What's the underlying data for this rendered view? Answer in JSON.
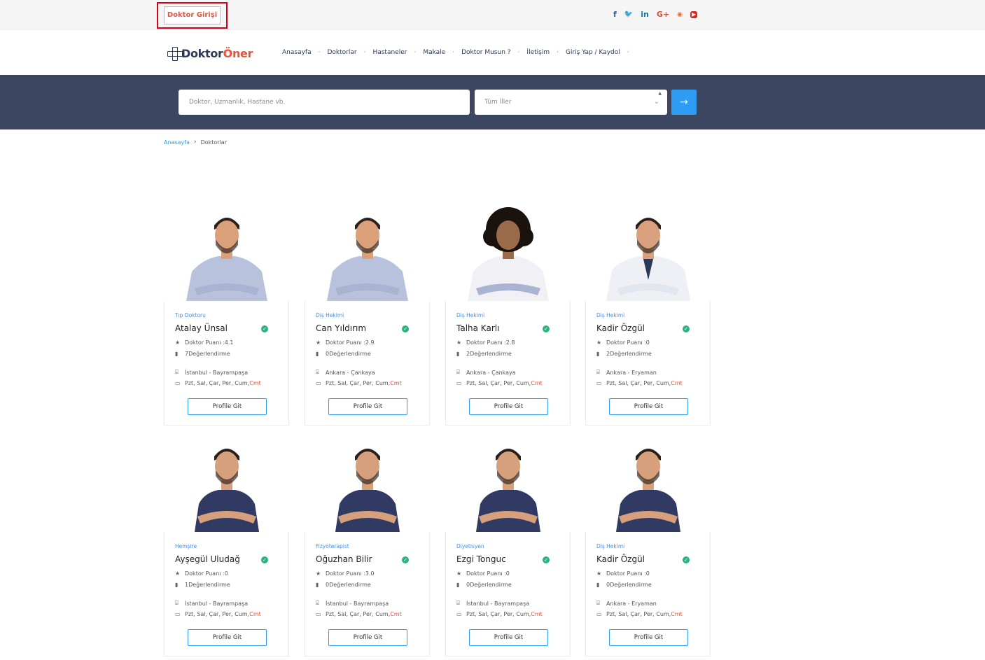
{
  "topbar": {
    "doctor_login": "Doktor Girişi",
    "social": [
      {
        "icon": "facebook-icon",
        "glyph": "f",
        "color": "#3b5998"
      },
      {
        "icon": "twitter-icon",
        "glyph": "🐦",
        "color": "#1da1f2"
      },
      {
        "icon": "linkedin-icon",
        "glyph": "in",
        "color": "#0e76a8"
      },
      {
        "icon": "google-plus-icon",
        "glyph": "G+",
        "color": "#dd4b39"
      },
      {
        "icon": "rss-icon",
        "glyph": "◉",
        "color": "#f26522"
      },
      {
        "icon": "youtube-icon",
        "glyph": "▶",
        "color": "#e62117"
      }
    ]
  },
  "brand": {
    "part1": "Doktor",
    "part2": "Öner"
  },
  "nav": {
    "items": [
      "Anasayfa",
      "Doktorlar",
      "Hastaneler",
      "Makale",
      "Doktor Musun ?",
      "İletişim",
      "Giriş Yap / Kaydol"
    ]
  },
  "search": {
    "placeholder": "Doktor, Uzmanlık, Hastane vb.",
    "city_select": "Tüm İller",
    "submit_icon": "arrow-right-icon"
  },
  "breadcrumb": {
    "home": "Anasayfa",
    "current": "Doktorlar"
  },
  "labels": {
    "score_prefix": "Doktor Puanı : ",
    "reviews_suffix": " Değerlendirme",
    "days": "Pzt, Sal, Çar, Per, Cum, ",
    "days_highlight": "Cmt",
    "profile_button": "Profile Git"
  },
  "doctors": [
    {
      "specialty": "Tıp Doktoru",
      "name": "Atalay Ünsal",
      "score": "4.1",
      "reviews": "7",
      "location": "İstanbul - Bayrampaşa",
      "shirt": "#b9c2dc",
      "skin": "#d9a07a",
      "hair": "#2a1f1a",
      "style": "sleeve"
    },
    {
      "specialty": "Diş Hekimi",
      "name": "Can Yıldırım",
      "score": "2.9",
      "reviews": "0",
      "location": "Ankara - Çankaya",
      "shirt": "#b9c2dc",
      "skin": "#d9a07a",
      "hair": "#2a1f1a",
      "style": "sleeve"
    },
    {
      "specialty": "Diş Hekimi",
      "name": "Talha Karlı",
      "score": "2.8",
      "reviews": "2",
      "location": "Ankara - Çankaya",
      "shirt": "#f0f0f5",
      "skin": "#9b6a4a",
      "hair": "#1a120d",
      "style": "curly"
    },
    {
      "specialty": "Diş Hekimi",
      "name": "Kadir Özgül",
      "score": "0",
      "reviews": "2",
      "location": "Ankara - Eryaman",
      "shirt": "#eef0f5",
      "skin": "#d8a07c",
      "hair": "#2a1f1a",
      "style": "coat"
    },
    {
      "specialty": "Hemşire",
      "name": "Ayşegül Uludağ",
      "score": "0",
      "reviews": "1",
      "location": "İstanbul - Bayrampaşa",
      "shirt": "#303a63",
      "skin": "#d6a07c",
      "hair": "#2a1f1a",
      "style": "tee"
    },
    {
      "specialty": "Fizyoterapist",
      "name": "Oğuzhan Bilir",
      "score": "3.0",
      "reviews": "0",
      "location": "İstanbul - Bayrampaşa",
      "shirt": "#303a63",
      "skin": "#d6a07c",
      "hair": "#2a1f1a",
      "style": "tee"
    },
    {
      "specialty": "Diyetisyen",
      "name": "Ezgi Tonguc",
      "score": "0",
      "reviews": "0",
      "location": "İstanbul - Bayrampaşa",
      "shirt": "#303a63",
      "skin": "#d6a07c",
      "hair": "#2a1f1a",
      "style": "tee"
    },
    {
      "specialty": "Diş Hekimi",
      "name": "Kadir Özgül",
      "score": "0",
      "reviews": "0",
      "location": "Ankara - Eryaman",
      "shirt": "#303a63",
      "skin": "#d6a07c",
      "hair": "#2a1f1a",
      "style": "tee"
    }
  ],
  "colors": {
    "accent": "#2e9cf2",
    "brand_red": "#e8513c",
    "navy": "#2b3a55",
    "band": "#3d4660",
    "verified": "#28b47c"
  }
}
